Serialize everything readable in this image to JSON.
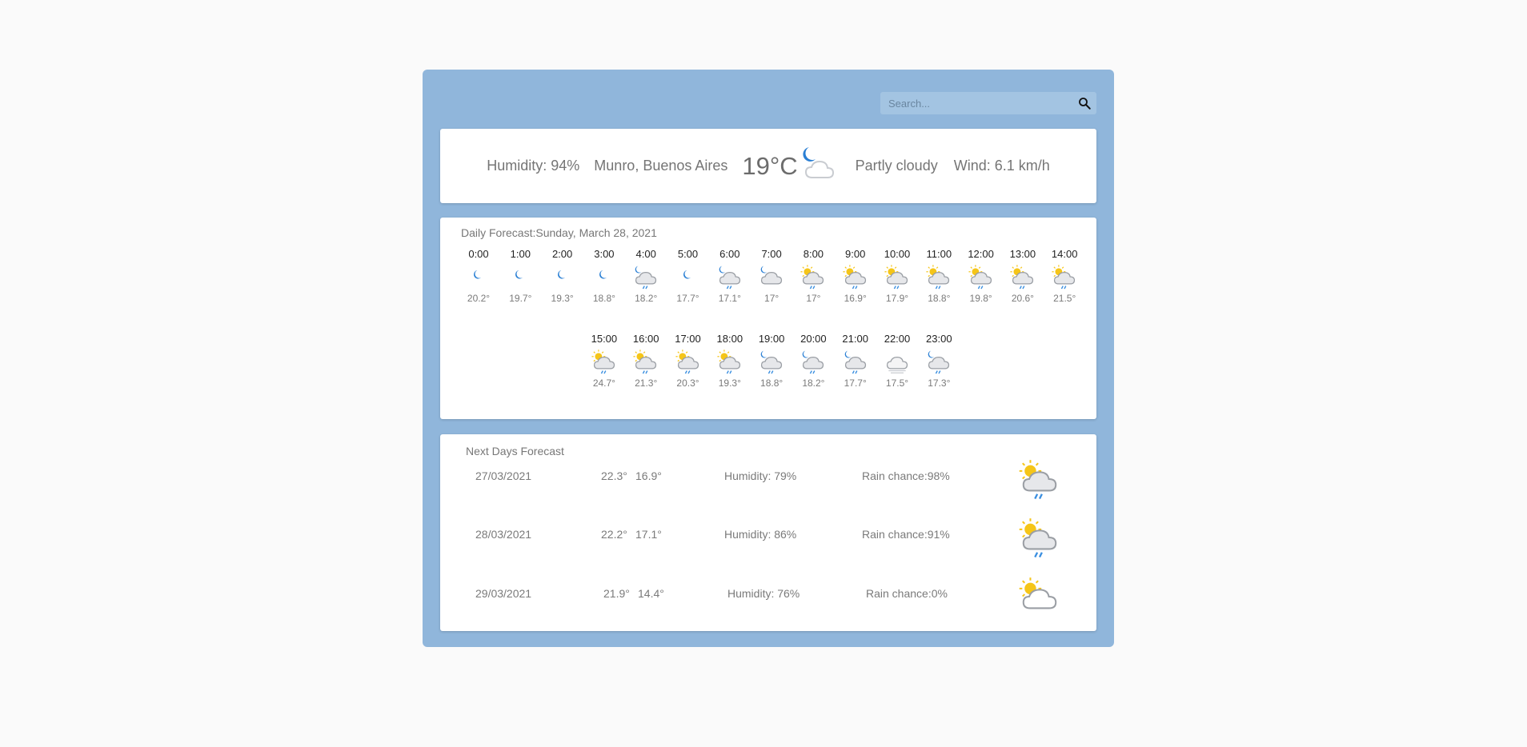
{
  "search": {
    "placeholder": "Search..."
  },
  "current": {
    "humidity": "Humidity: 94%",
    "location": "Munro, Buenos Aires",
    "temperature": "19°C",
    "icon": "night-partly-cloudy-icon",
    "condition": "Partly cloudy",
    "wind": "Wind: 6.1 km/h"
  },
  "daily": {
    "title": "Daily Forecast:",
    "date": "Sunday, March 28, 2021",
    "hours": [
      {
        "time": "0:00",
        "temp": "20.2°",
        "icon": "moon"
      },
      {
        "time": "1:00",
        "temp": "19.7°",
        "icon": "moon"
      },
      {
        "time": "2:00",
        "temp": "19.3°",
        "icon": "moon"
      },
      {
        "time": "3:00",
        "temp": "18.8°",
        "icon": "moon"
      },
      {
        "time": "4:00",
        "temp": "18.2°",
        "icon": "moon-rain"
      },
      {
        "time": "5:00",
        "temp": "17.7°",
        "icon": "moon"
      },
      {
        "time": "6:00",
        "temp": "17.1°",
        "icon": "moon-rain"
      },
      {
        "time": "7:00",
        "temp": "17°",
        "icon": "moon-cloud"
      },
      {
        "time": "8:00",
        "temp": "17°",
        "icon": "sun-rain"
      },
      {
        "time": "9:00",
        "temp": "16.9°",
        "icon": "sun-rain"
      },
      {
        "time": "10:00",
        "temp": "17.9°",
        "icon": "sun-rain"
      },
      {
        "time": "11:00",
        "temp": "18.8°",
        "icon": "sun-rain"
      },
      {
        "time": "12:00",
        "temp": "19.8°",
        "icon": "sun-rain"
      },
      {
        "time": "13:00",
        "temp": "20.6°",
        "icon": "sun-rain"
      },
      {
        "time": "14:00",
        "temp": "21.5°",
        "icon": "sun-rain"
      },
      {
        "time": "15:00",
        "temp": "24.7°",
        "icon": "sun-rain"
      },
      {
        "time": "16:00",
        "temp": "21.3°",
        "icon": "sun-rain"
      },
      {
        "time": "17:00",
        "temp": "20.3°",
        "icon": "sun-rain"
      },
      {
        "time": "18:00",
        "temp": "19.3°",
        "icon": "sun-rain"
      },
      {
        "time": "19:00",
        "temp": "18.8°",
        "icon": "moon-rain"
      },
      {
        "time": "20:00",
        "temp": "18.2°",
        "icon": "moon-rain"
      },
      {
        "time": "21:00",
        "temp": "17.7°",
        "icon": "moon-rain"
      },
      {
        "time": "22:00",
        "temp": "17.5°",
        "icon": "fog"
      },
      {
        "time": "23:00",
        "temp": "17.3°",
        "icon": "moon-rain"
      }
    ]
  },
  "next_days": {
    "title": "Next Days Forecast",
    "days": [
      {
        "date": "27/03/2021",
        "max": "22.3°",
        "min": "16.9°",
        "humidity": "Humidity: 79%",
        "rain": "Rain chance:98%",
        "icon": "sun-rain"
      },
      {
        "date": "28/03/2021",
        "max": "22.2°",
        "min": "17.1°",
        "humidity": "Humidity: 86%",
        "rain": "Rain chance:91%",
        "icon": "sun-rain"
      },
      {
        "date": "29/03/2021",
        "max": "21.9°",
        "min": "14.4°",
        "humidity": "Humidity: 76%",
        "rain": "Rain chance:0%",
        "icon": "sun-cloud"
      }
    ]
  },
  "colors": {
    "panel": "#90b6db",
    "moon": "#2a7fd4",
    "sun": "#f5c518",
    "rain": "#3b8fe0",
    "cloud": "#c9ccd1"
  }
}
